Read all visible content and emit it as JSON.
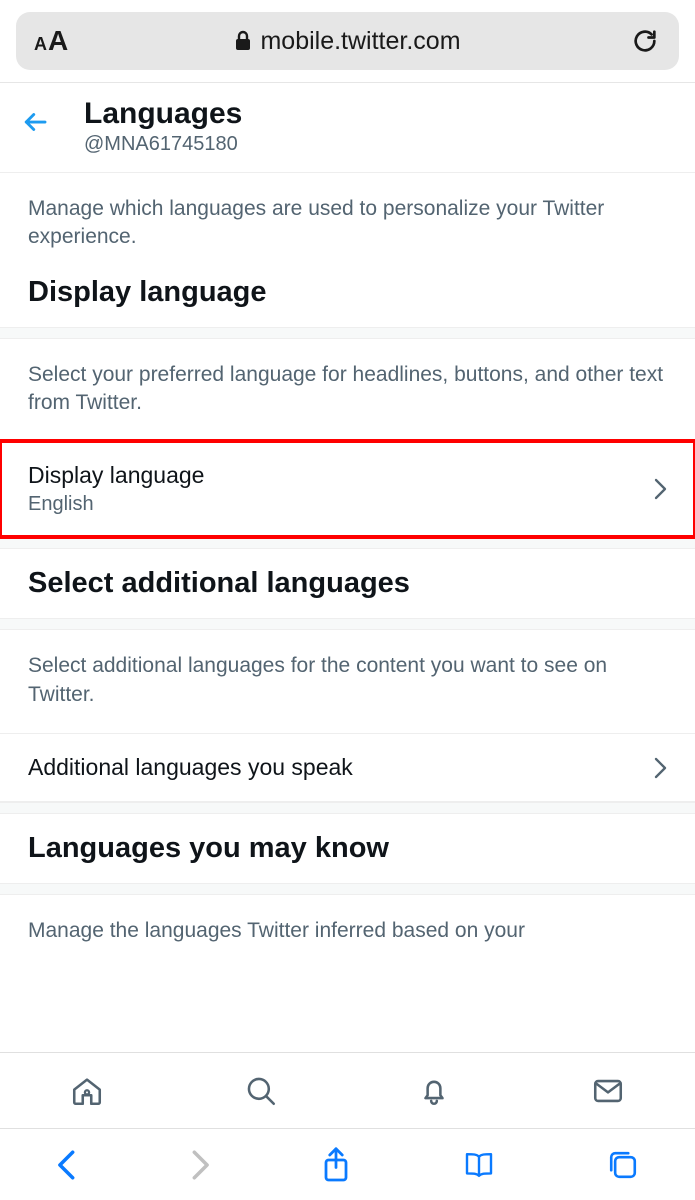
{
  "browser": {
    "url": "mobile.twitter.com"
  },
  "header": {
    "title": "Languages",
    "handle": "@MNA61745180"
  },
  "intro": "Manage which languages are used to personalize your Twitter experience.",
  "section1": {
    "title": "Display language",
    "desc": "Select your preferred language for headlines, buttons, and other text from Twitter.",
    "row": {
      "label": "Display language",
      "value": "English"
    }
  },
  "section2": {
    "title": "Select additional languages",
    "desc": "Select additional languages for the content you want to see on Twitter.",
    "row": {
      "label": "Additional languages you speak"
    }
  },
  "section3": {
    "title": "Languages you may know",
    "desc": "Manage the languages Twitter inferred based on your"
  }
}
